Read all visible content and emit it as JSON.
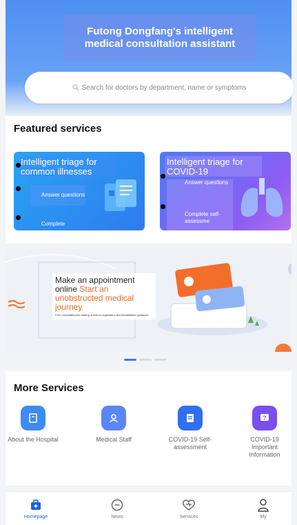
{
  "header": {
    "title": "Futong Dongfang's intelligent medical consultation assistant",
    "search_placeholder": "Search for doctors by department, name or symptoms"
  },
  "featured": {
    "title": "Featured services",
    "cards": [
      {
        "title": "Intelligent triage for common illnesses",
        "sub1": "Answer questions",
        "sub2": "Complete"
      },
      {
        "title": "Intelligent triage for COVID-19",
        "sub1": "Answer questions",
        "sub2": "Complete self-assessme"
      }
    ]
  },
  "banner": {
    "line1": "Make an appointment",
    "line2": "online",
    "highlight": "Start an unobstructed medical journey",
    "small": "Free consultation/no waiting in line/no registration fee/rehabilitation guidance",
    "page": 1,
    "pages": 3
  },
  "more": {
    "title": "More Services",
    "items": [
      {
        "label": "About the Hospital",
        "icon": "hospital-icon",
        "color": "#3d8cf0"
      },
      {
        "label": "Medical Staff",
        "icon": "doctor-icon",
        "color": "#5b86f5"
      },
      {
        "label": "COVID-19 Self-assessment",
        "icon": "document-icon",
        "color": "#2f6ff0"
      },
      {
        "label": "COVID-19 Important Information",
        "icon": "info-icon",
        "color": "#7a4ff0"
      }
    ]
  },
  "tabs": [
    {
      "label": "Homepage",
      "icon": "home-icon",
      "active": true
    },
    {
      "label": "News",
      "icon": "chat-icon",
      "active": false
    },
    {
      "label": "Services",
      "icon": "heart-icon",
      "active": false
    },
    {
      "label": "My",
      "icon": "user-icon",
      "active": false
    }
  ],
  "colors": {
    "accent": "#1c63d8",
    "highlight": "#f06a2a"
  }
}
